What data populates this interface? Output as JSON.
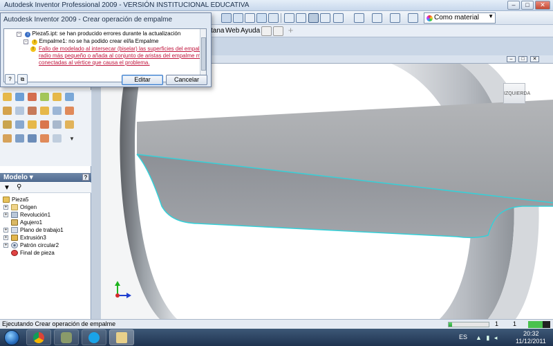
{
  "app": {
    "title": "Autodesk Inventor Professional 2009 - VERSIÓN INSTITUCIONAL EDUCATIVA",
    "window_controls": [
      "–",
      "□",
      "✕"
    ]
  },
  "toolbar": {
    "material_value": "Como material"
  },
  "menu": {
    "items": [
      "tana",
      "Web",
      "Ayuda"
    ]
  },
  "dialog": {
    "title": "Autodesk Inventor 2009 - Crear operación de empalme",
    "rows": [
      {
        "text": "Pieza5.ipt: se han producido errores durante la actualización"
      },
      {
        "text": "Empalme1: no se ha podido crear el/la Empalme"
      },
      {
        "text": "Fallo de modelado al intersecar (biselar) las superficies del empalme. Use u"
      },
      {
        "text": "radio más pequeño o añada al conjunto de aristas del empalme más arista"
      },
      {
        "text": "conectadas al vértice que causa el problema."
      }
    ],
    "edit_button": "Editar",
    "cancel_button": "Cancelar",
    "help_glyph": "?",
    "copy_glyph": "⧉"
  },
  "browser": {
    "header": "Modelo",
    "help_glyph": "?",
    "tree": [
      {
        "label": "Pieza5",
        "icon": "part-icon",
        "expand": ""
      },
      {
        "label": "Origen",
        "icon": "folder-icon",
        "expand": "+"
      },
      {
        "label": "Revolución1",
        "icon": "revolve-icon",
        "expand": "+"
      },
      {
        "label": "Agujero1",
        "icon": "hole-icon",
        "expand": ""
      },
      {
        "label": "Plano de trabajo1",
        "icon": "workplane-icon",
        "expand": "+"
      },
      {
        "label": "Extrusión3",
        "icon": "extrude-icon",
        "expand": "+"
      },
      {
        "label": "Patrón circular2",
        "icon": "pattern-icon",
        "expand": "+"
      },
      {
        "label": "Final de pieza",
        "icon": "end-of-part-icon",
        "expand": ""
      }
    ]
  },
  "viewport": {
    "viewcube_label": "IZQUIERDA",
    "controls": [
      "–",
      "□",
      "✕"
    ]
  },
  "status": {
    "text": "Ejecutando Crear operación de empalme",
    "progress": 0.08,
    "num1": "1",
    "num2": "1",
    "meter": 0.65
  },
  "taskbar": {
    "language": "ES",
    "time": "20:32",
    "date": "11/12/2011"
  },
  "colors": {
    "edge_highlight": "#35d0d8",
    "error_text": "#c0143c"
  }
}
